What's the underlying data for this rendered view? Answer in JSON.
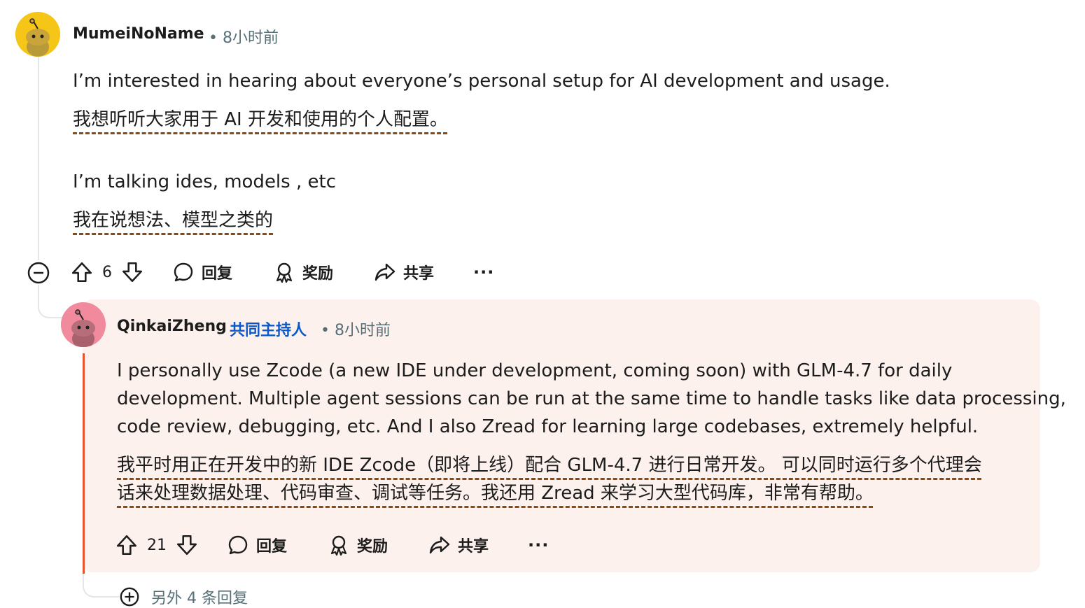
{
  "comment": {
    "username": "MumeiNoName",
    "meta": "• 8小时前",
    "text_en_1": "I’m interested in hearing about everyone’s personal setup for AI development and usage.",
    "text_zh_1": "我想听听大家用于 AI 开发和使用的个人配置。",
    "text_en_2": "I’m talking ides, models , etc",
    "text_zh_2": "我在说想法、模型之类的",
    "votes": "6",
    "reply_label": "回复",
    "award_label": "奖励",
    "share_label": "共享",
    "more_label": "···"
  },
  "reply": {
    "username": "QinkaiZheng",
    "role": "共同主持人",
    "meta": "• 8小时前",
    "text_en_lines": [
      "I personally use Zcode (a new IDE under development, coming soon) with GLM-4.7 for daily",
      "development. Multiple agent sessions can be run at the same time to handle tasks like data processing,",
      "code review, debugging, etc. And I also Zread for learning large codebases, extremely helpful."
    ],
    "text_zh_lines": [
      "我平时用正在开发中的新 IDE Zcode（即将上线）配合 GLM-4.7 进行日常开发。 可以同时运行多个代理会",
      "话来处理数据处理、代码审查、调试等任务。我还用 Zread 来学习大型代码库，非常有帮助。"
    ],
    "votes": "21",
    "reply_label": "回复",
    "award_label": "奖励",
    "share_label": "共享",
    "more_label": "···"
  },
  "more_replies": "另外 4 条回复",
  "colors": {
    "reply_bg": "#fdf1ee",
    "accent_bar": "#e8542f",
    "role_blue": "#0a58ca",
    "zh_underline": "#8b4a14",
    "avatar1": "#f5c518",
    "avatar2": "#f28a9e"
  }
}
